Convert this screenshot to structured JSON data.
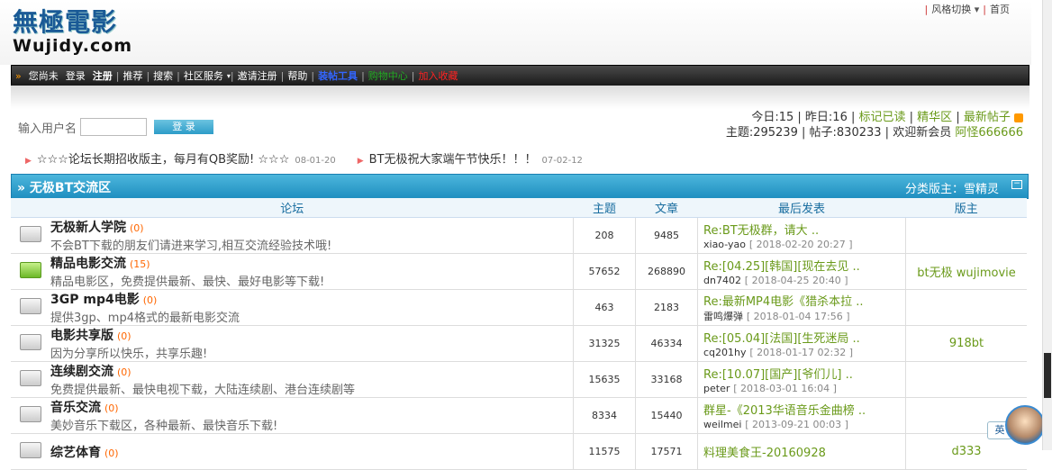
{
  "logo": {
    "cn": "無極電影",
    "en": "Wujidy.com"
  },
  "toplinks": {
    "style": "风格切换",
    "home": "首页"
  },
  "nav": {
    "guest": "您尚未",
    "login": "登录",
    "register": "注册",
    "items": [
      "推荐",
      "搜索",
      "社区服务",
      "邀请注册",
      "帮助"
    ],
    "blue_item": "装帖工具",
    "green_item": "购物中心",
    "red_item": "加入收藏"
  },
  "login": {
    "label": "输入用户名",
    "button": "登 录"
  },
  "stats": {
    "today_label": "今日:",
    "today": "15",
    "yesterday_label": "昨日:",
    "yesterday": "16",
    "mark_read": "标记已读",
    "digest": "精华区",
    "latest": "最新帖子",
    "topics_label": "主题:",
    "topics": "295239",
    "posts_label": "帖子:",
    "posts": "830233",
    "welcome_label": "欢迎新会员",
    "new_member": "阿怪666666"
  },
  "announcements": [
    {
      "text": "☆☆☆论坛长期招收版主，每月有QB奖励! ☆☆☆",
      "date": "08-01-20"
    },
    {
      "text": "BT无极祝大家端午节快乐！！！",
      "date": "07-02-12"
    }
  ],
  "section": {
    "title": "» 无极BT交流区",
    "moderator": "分类版主：雪精灵",
    "collapse": "−"
  },
  "table": {
    "headers": [
      "论坛",
      "主题",
      "文章",
      "最后发表",
      "版主"
    ],
    "rows": [
      {
        "name": "无极新人学院",
        "count": "(0)",
        "desc": "不会BT下载的朋友们请进来学习,相互交流经验技术哦!",
        "topics": "208",
        "posts": "9485",
        "last_title": "Re:BT无极群，请大 ..",
        "last_user": "xiao-yao",
        "last_date": "[ 2018-02-20 20:27 ]",
        "mod": ""
      },
      {
        "name": "精品电影交流",
        "count": "(15)",
        "desc": "精品电影区，免费提供最新、最快、最好电影等下载!",
        "topics": "57652",
        "posts": "268890",
        "last_title": "Re:[04.25][韩国][现在去见 ..",
        "last_user": "dn7402",
        "last_date": "[ 2018-04-25 20:40 ]",
        "mod": "bt无极 wujimovie"
      },
      {
        "name": "3GP mp4电影",
        "count": "(0)",
        "desc": "提供3gp、mp4格式的最新电影交流",
        "topics": "463",
        "posts": "2183",
        "last_title": "Re:最新MP4电影《猎杀本拉 ..",
        "last_user": "雷鸣爆弹",
        "last_date": "[ 2018-01-04 17:56 ]",
        "mod": ""
      },
      {
        "name": "电影共享版",
        "count": "(0)",
        "desc": "因为分享所以快乐，共享乐趣!",
        "topics": "31325",
        "posts": "46334",
        "last_title": "Re:[05.04][法国][生死迷局 ..",
        "last_user": "cq201hy",
        "last_date": "[ 2018-01-17 02:32 ]",
        "mod": "918bt"
      },
      {
        "name": "连续剧交流",
        "count": "(0)",
        "desc": "免费提供最新、最快电视下载，大陆连续剧、港台连续剧等",
        "topics": "15635",
        "posts": "33168",
        "last_title": "Re:[10.07][国产][爷们儿] ..",
        "last_user": "peter",
        "last_date": "[ 2018-03-01 16:04 ]",
        "mod": ""
      },
      {
        "name": "音乐交流",
        "count": "(0)",
        "desc": "美妙音乐下载区，各种最新、最快音乐下载!",
        "topics": "8334",
        "posts": "15440",
        "last_title": "群星-《2013华语音乐金曲榜 ..",
        "last_user": "weilmei",
        "last_date": "[ 2013-09-21 00:03 ]",
        "mod": ""
      },
      {
        "name": "综艺体育",
        "count": "(0)",
        "desc": "",
        "topics": "11575",
        "posts": "17571",
        "last_title": "料理美食王-20160928",
        "last_user": "",
        "last_date": "",
        "mod": "d333"
      }
    ]
  },
  "ime": {
    "label": "英"
  }
}
